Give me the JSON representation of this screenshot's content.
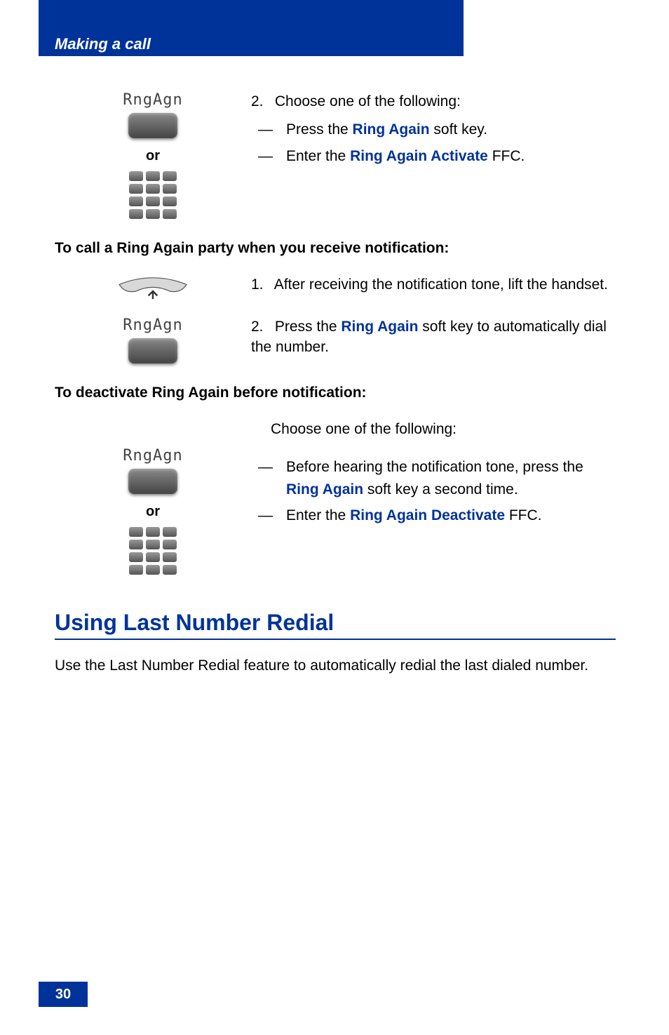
{
  "header": {
    "title": "Making a call"
  },
  "labels": {
    "rngAgn": "RngAgn",
    "or": "or"
  },
  "section1": {
    "step": {
      "num": "2.",
      "text": "Choose one of the following:"
    },
    "items": [
      {
        "prefix": "—",
        "pre": "Press the ",
        "key": "Ring Again",
        "post": " soft key."
      },
      {
        "prefix": "—",
        "pre": "Enter the ",
        "key": "Ring Again Activate",
        "post": " FFC."
      }
    ]
  },
  "heading2": "To call a Ring Again party when you receive notification:",
  "section2a": {
    "num": "1.",
    "text": "After receiving the notification tone, lift the handset."
  },
  "section2b": {
    "num": "2.",
    "pre": "Press the ",
    "key": "Ring Again",
    "post": " soft key to automatically dial the number."
  },
  "heading3": "To deactivate Ring Again before notification:",
  "section3": {
    "intro": "Choose one of the following:",
    "items": [
      {
        "prefix": "—",
        "pre": "Before hearing the notification tone, press the ",
        "key": "Ring Again",
        "post": " soft key a second time."
      },
      {
        "prefix": "—",
        "pre": "Enter the ",
        "key": "Ring Again Deactivate",
        "post": " FFC."
      }
    ]
  },
  "h2": "Using Last Number Redial",
  "body": "Use the Last Number Redial feature to automatically redial the last dialed number.",
  "pageNum": "30"
}
